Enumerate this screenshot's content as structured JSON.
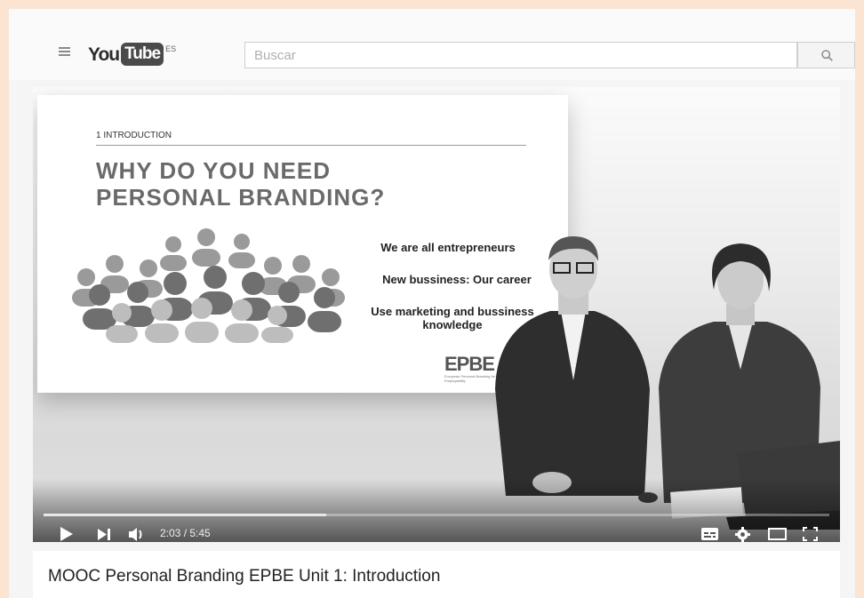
{
  "masthead": {
    "logo": {
      "you": "You",
      "tube": "Tube",
      "region": "ES"
    },
    "search": {
      "placeholder": "Buscar",
      "button_icon": "search-icon"
    },
    "menu_icon": "menu-icon"
  },
  "slide": {
    "section": "1 INTRODUCTION",
    "title_line1": "WHY DO YOU NEED",
    "title_line2": "PERSONAL BRANDING?",
    "bullets": [
      "We are all entrepreneurs",
      "New bussiness: Our career",
      "Use marketing and bussiness knowledge"
    ],
    "logo": {
      "letters": "EPBE",
      "subtitle": "European Personal Branding for Employability"
    }
  },
  "player": {
    "current_time": "2:03",
    "duration": "5:45",
    "time_display": "2:03 / 5:45",
    "progress_fraction": 0.36,
    "controls": [
      "play-icon",
      "next-icon",
      "volume-icon",
      "subtitles-icon",
      "settings-icon",
      "theater-icon",
      "fullscreen-icon"
    ]
  },
  "video": {
    "title": "MOOC Personal Branding EPBE Unit 1: Introduction"
  }
}
